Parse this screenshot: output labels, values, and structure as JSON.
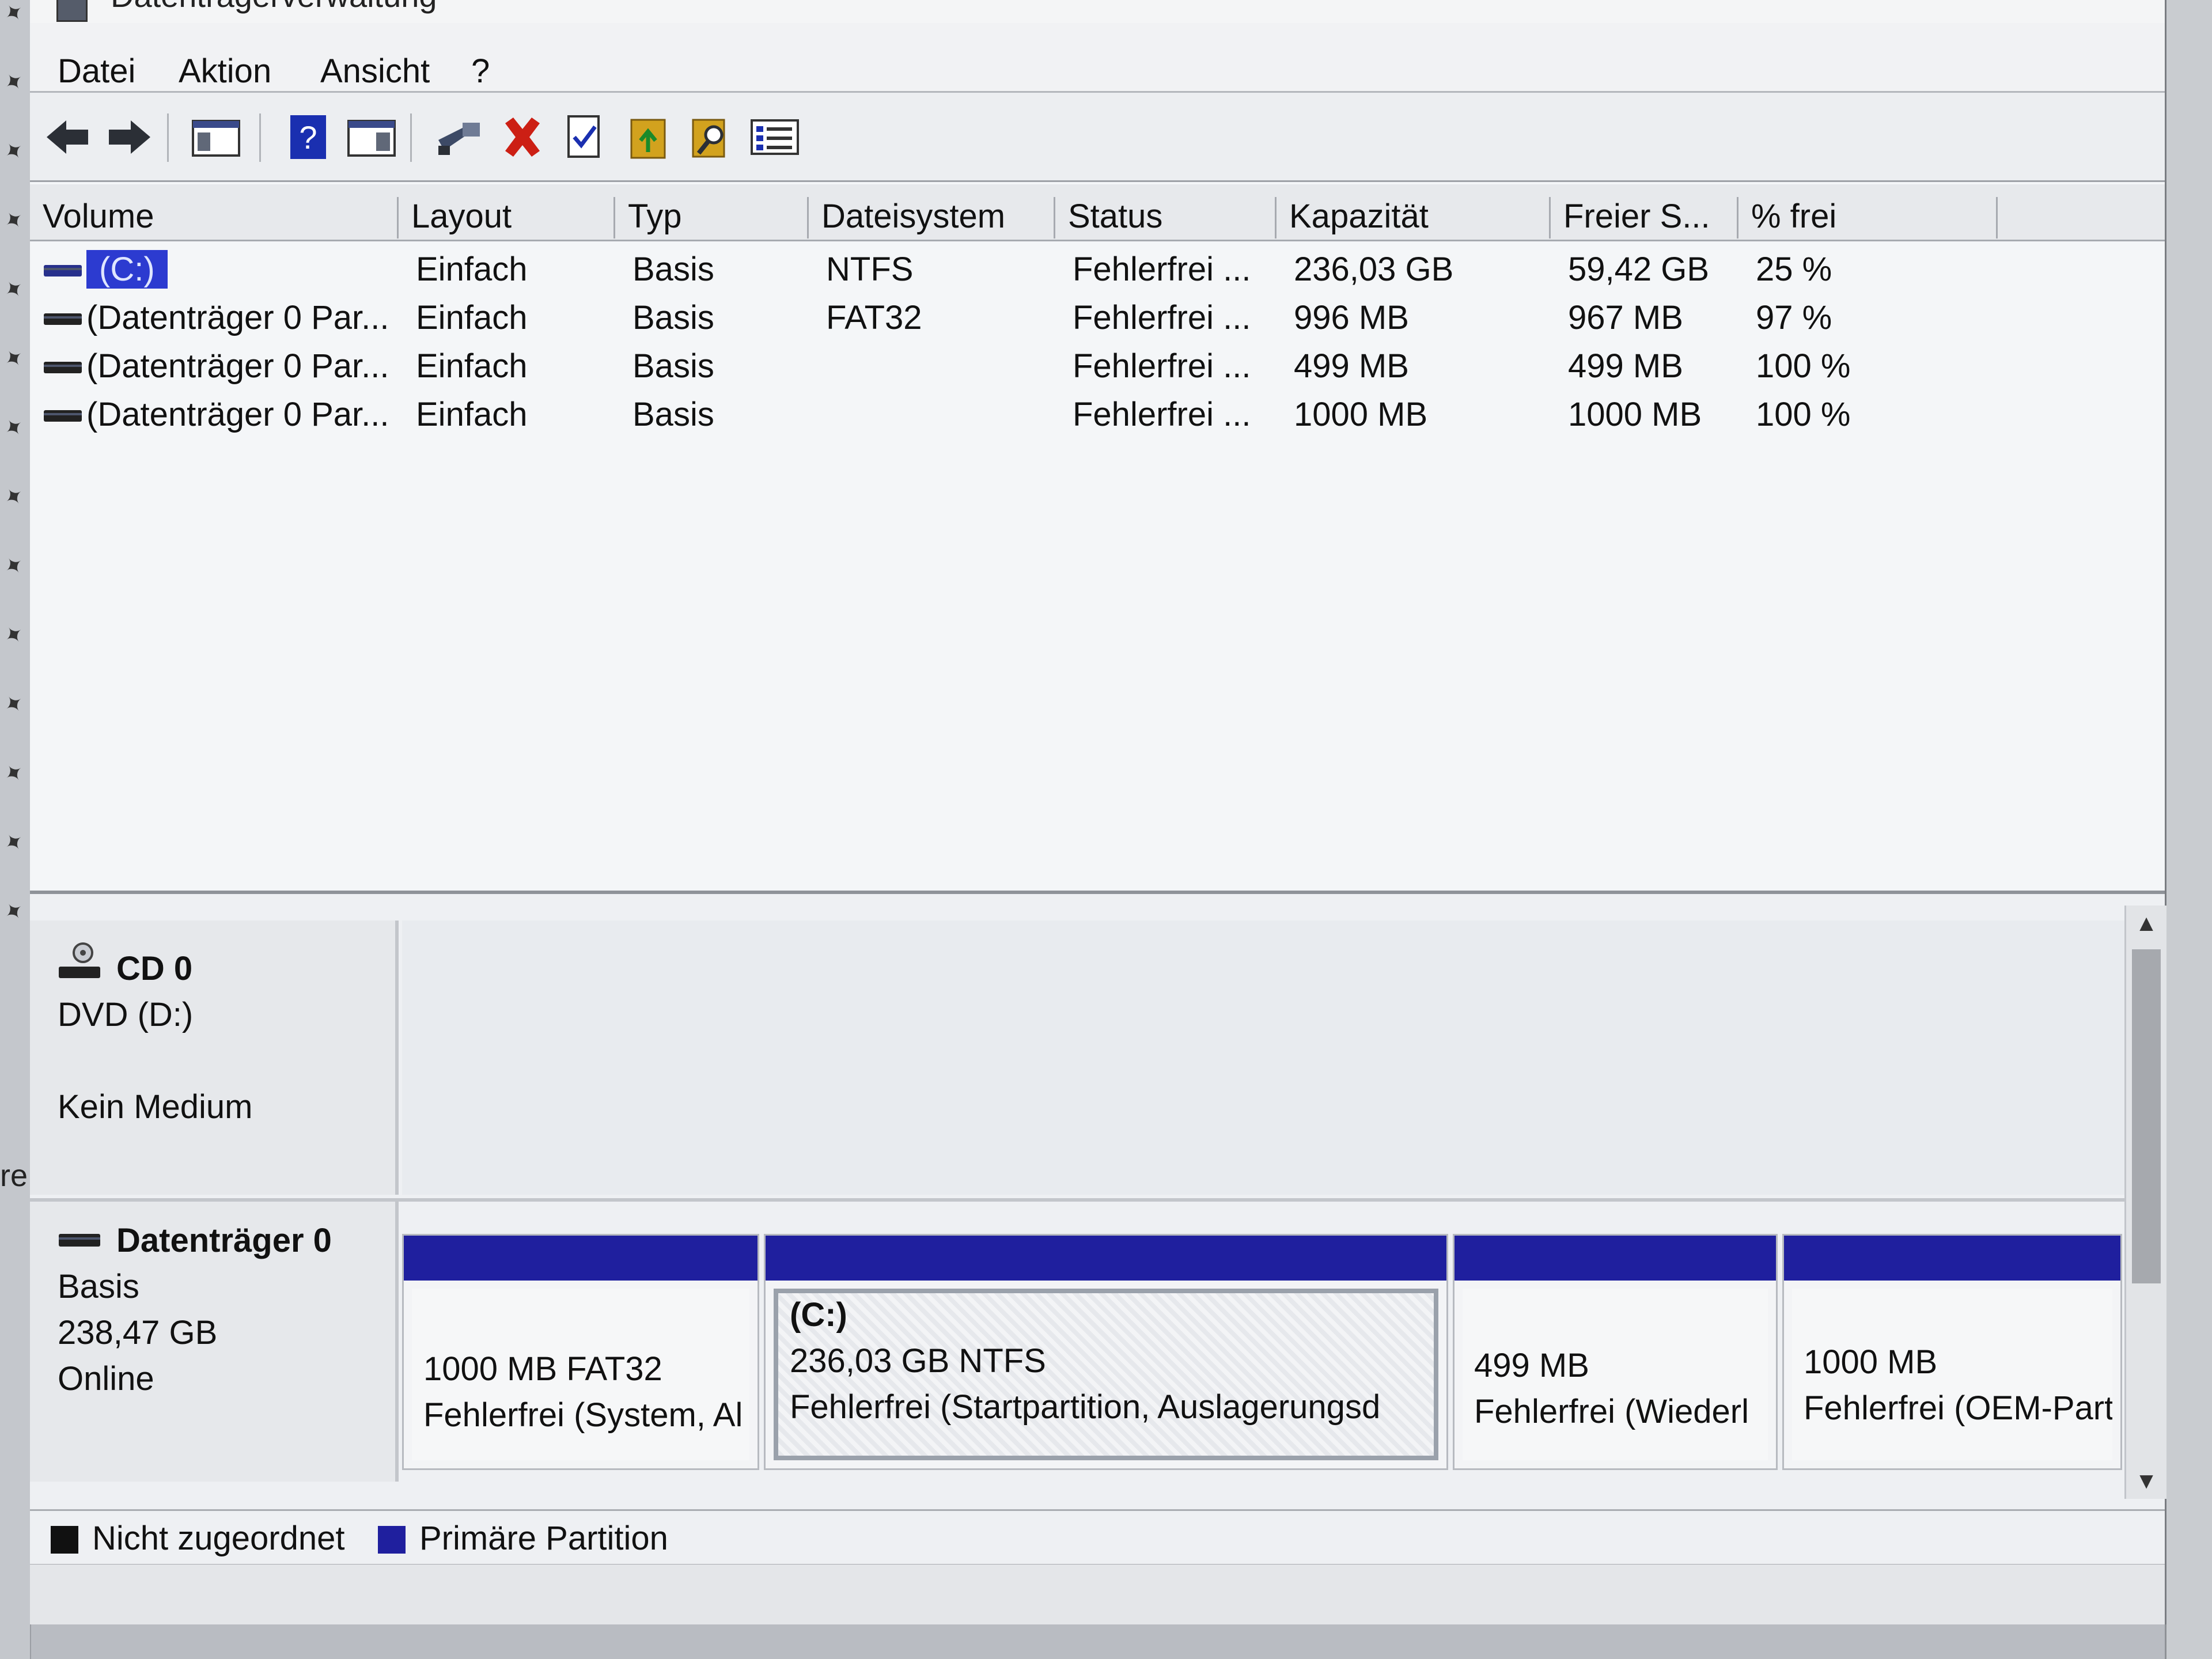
{
  "window": {
    "title": "Datenträgerverwaltung"
  },
  "menu": [
    "Datei",
    "Aktion",
    "Ansicht",
    "?"
  ],
  "toolbar": {
    "buttons": [
      "back-arrow-icon",
      "forward-arrow-icon",
      "console-tree-icon",
      "help-icon",
      "properties-pane-icon",
      "connect-icon",
      "delete-icon",
      "check-icon",
      "import-icon",
      "search-icon",
      "list-view-icon"
    ],
    "colors": {
      "accent": "#1f1f9e",
      "delete": "#cc1f14",
      "help": "#1a2fb0",
      "folder": "#d2a21e"
    }
  },
  "volume_table": {
    "columns": [
      "Volume",
      "Layout",
      "Typ",
      "Dateisystem",
      "Status",
      "Kapazität",
      "Freier S...",
      "% frei"
    ],
    "rows": [
      {
        "volume": "(C:)",
        "layout": "Einfach",
        "typ": "Basis",
        "dateisystem": "NTFS",
        "status": "Fehlerfrei ...",
        "kapazitaet": "236,03 GB",
        "frei": "59,42 GB",
        "prozent": "25 %",
        "selected": true
      },
      {
        "volume": "(Datenträger 0 Par...",
        "layout": "Einfach",
        "typ": "Basis",
        "dateisystem": "FAT32",
        "status": "Fehlerfrei ...",
        "kapazitaet": "996 MB",
        "frei": "967 MB",
        "prozent": "97 %"
      },
      {
        "volume": "(Datenträger 0 Par...",
        "layout": "Einfach",
        "typ": "Basis",
        "dateisystem": "",
        "status": "Fehlerfrei ...",
        "kapazitaet": "499 MB",
        "frei": "499 MB",
        "prozent": "100 %"
      },
      {
        "volume": "(Datenträger 0 Par...",
        "layout": "Einfach",
        "typ": "Basis",
        "dateisystem": "",
        "status": "Fehlerfrei ...",
        "kapazitaet": "1000 MB",
        "frei": "1000 MB",
        "prozent": "100 %"
      }
    ]
  },
  "disks": {
    "cd": {
      "name": "CD 0",
      "drive": "DVD (D:)",
      "medium": "Kein Medium"
    },
    "disk0": {
      "name": "Datenträger 0",
      "type": "Basis",
      "size": "238,47 GB",
      "state": "Online",
      "partitions": [
        {
          "title": "",
          "line1": "1000 MB FAT32",
          "line2": "Fehlerfrei (System, Al"
        },
        {
          "title": "(C:)",
          "line1": "236,03 GB NTFS",
          "line2": "Fehlerfrei (Startpartition, Auslagerungsd"
        },
        {
          "title": "",
          "line1": "499 MB",
          "line2": "Fehlerfrei (Wiederl"
        },
        {
          "title": "",
          "line1": "1000 MB",
          "line2": "Fehlerfrei (OEM-Partit"
        }
      ]
    }
  },
  "legend": {
    "unallocated": {
      "label": "Nicht zugeordnet",
      "color": "#111111"
    },
    "primary": {
      "label": "Primäre Partition",
      "color": "#1f1f9e"
    }
  },
  "edge_fragment": "re"
}
